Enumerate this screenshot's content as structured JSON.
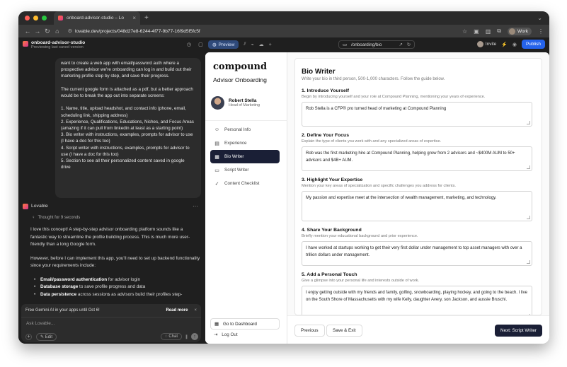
{
  "browser": {
    "tab_title": "onboard-advisor-studio – Lo",
    "url": "lovable.dev/projects/048d27e8-6244-4f77-9b77-16f9d5f5fc5f",
    "profile_label": "Work",
    "traffic_colors": [
      "#ff5f57",
      "#febc2e",
      "#28c840"
    ]
  },
  "app": {
    "project_name": "onboard-advisor-studio",
    "project_status": "Previewing last saved version",
    "preview_label": "Preview",
    "route": "/onboarding/bio",
    "invite_label": "Invite",
    "publish_label": "Publish",
    "accent": "#2563eb"
  },
  "chat": {
    "user_message": [
      "want to create a web app with email/password auth where a prospective advisor we're onboarding can log in and build out their marketing profile step by step, and save their progress.",
      "The current google form is attached as a pdf, but a better approach would be to break the app out into separate screens:",
      "1. Name, title, upload headshot, and contact info (phone, email, scheduling link, shipping address)\n2. Experience, Qualifications, Educations, Niches, and Focus Areas (amazing if it can pull from linkedin at least as a starting point)\n3. Bio writer with instructions, examples, prompts for advisor to use (I have a doc for this too)\n4. Script writer with instructions, examples, prompts for advisor to use (I have a doc for this too)\n5. Section to see all their personalized content saved in google drive"
    ],
    "assistant_name": "Lovable",
    "thought": "Thought for 9 seconds",
    "response_p1": "I love this concept! A step-by-step advisor onboarding platform sounds like a fantastic way to streamline the profile building process. This is much more user-friendly than a long Google form.",
    "response_p2": "However, before I can implement this app, you'll need to set up backend functionality since your requirements include:",
    "bullets": [
      {
        "bold": "Email/password authentication",
        "rest": " for advisor login"
      },
      {
        "bold": "Database storage",
        "rest": " to save profile progress and data"
      },
      {
        "bold": "Data persistence",
        "rest": " across sessions as advisors build their profiles step-"
      }
    ],
    "banner_text": "Free Gemini AI in your apps until Oct 6!",
    "banner_link": "Read more",
    "input_placeholder": "Ask Lovable...",
    "edit_label": "Edit",
    "chat_label": "Chat"
  },
  "preview": {
    "logo": "compound",
    "subtitle": "Advisor Onboarding",
    "user_name": "Robert Stella",
    "user_role": "Head of Marketing",
    "menu": [
      {
        "label": "Personal Info",
        "icon": "user-icon",
        "glyph": "☺",
        "active": false
      },
      {
        "label": "Experience",
        "icon": "briefcase-icon",
        "glyph": "▤",
        "active": false
      },
      {
        "label": "Bio Writer",
        "icon": "document-icon",
        "glyph": "▦",
        "active": true
      },
      {
        "label": "Script Writer",
        "icon": "video-icon",
        "glyph": "▭",
        "active": false
      },
      {
        "label": "Content Checklist",
        "icon": "checklist-icon",
        "glyph": "✓",
        "active": false
      }
    ],
    "dashboard_label": "Go to Dashboard",
    "logout_label": "Log Out",
    "title": "Bio Writer",
    "description": "Write your bio in third person, 500-1,000 characters. Follow the guide below.",
    "sections": [
      {
        "heading": "1. Introduce Yourself",
        "hint": "Begin by introducing yourself and your role at Compound Planning, mentioning your years of experience.",
        "value": "Rob Stella is a CFP® pro turned head of marketing at Compound Planning"
      },
      {
        "heading": "2. Define Your Focus",
        "hint": "Explain the type of clients you work with and any specialized areas of expertise.",
        "value": "Rob was the first marketing hire at Compound Planning, helping grow from 2 advisors and ~$400M AUM to 50+ advisors and $4B+ AUM."
      },
      {
        "heading": "3. Highlight Your Expertise",
        "hint": "Mention your key areas of specialization and specific challenges you address for clients.",
        "value": "My passion and expertise meet at the intersection of wealth management, marketing, and technology."
      },
      {
        "heading": "4. Share Your Background",
        "hint": "Briefly mention your educational background and prior experience.",
        "value": "I have worked at startups working to get their very first dollar under management to top asset managers with over a trillion dollars under management."
      },
      {
        "heading": "5. Add a Personal Touch",
        "hint": "Give a glimpse into your personal life and interests outside of work.",
        "value": "I enjoy getting outside with my friends and family, golfing, snowboarding, playing hockey, and going to the beach. I live on the South Shore of Massachusetts with my wife Kelly, daughter Avery, son Jackson, and aussie Bruschi."
      }
    ],
    "previous_label": "Previous",
    "save_exit_label": "Save & Exit",
    "next_label": "Next: Script Writer"
  }
}
